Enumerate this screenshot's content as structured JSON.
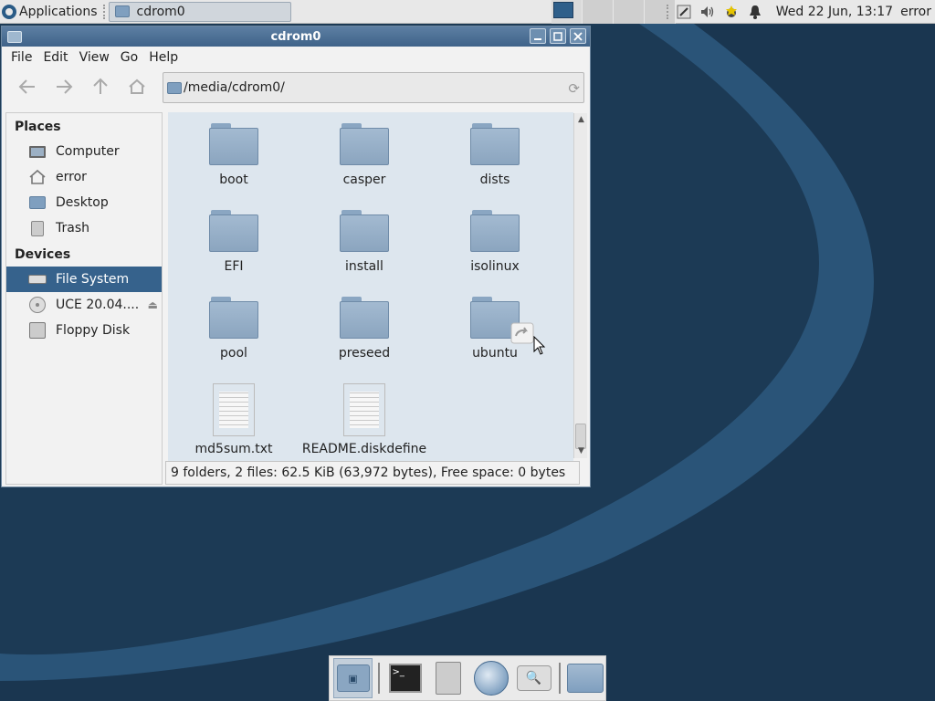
{
  "top_panel": {
    "applications_label": "Applications",
    "task_label": "cdrom0",
    "clock": "Wed 22 Jun, 13:17",
    "user": "error"
  },
  "window": {
    "title": "cdrom0",
    "menu": [
      "File",
      "Edit",
      "View",
      "Go",
      "Help"
    ],
    "path": "/media/cdrom0/",
    "sidebar": {
      "places_heading": "Places",
      "places": [
        {
          "label": "Computer",
          "icon": "computer-icon"
        },
        {
          "label": "error",
          "icon": "home-icon"
        },
        {
          "label": "Desktop",
          "icon": "desktop-icon"
        },
        {
          "label": "Trash",
          "icon": "trash-icon"
        }
      ],
      "devices_heading": "Devices",
      "devices": [
        {
          "label": "File System",
          "icon": "drive-icon",
          "selected": true
        },
        {
          "label": "UCE 20.04....",
          "icon": "disc-icon"
        },
        {
          "label": "Floppy Disk",
          "icon": "floppy-icon"
        }
      ]
    },
    "files": [
      {
        "name": "boot",
        "type": "folder"
      },
      {
        "name": "casper",
        "type": "folder"
      },
      {
        "name": "dists",
        "type": "folder"
      },
      {
        "name": "EFI",
        "type": "folder"
      },
      {
        "name": "install",
        "type": "folder"
      },
      {
        "name": "isolinux",
        "type": "folder"
      },
      {
        "name": "pool",
        "type": "folder"
      },
      {
        "name": "preseed",
        "type": "folder"
      },
      {
        "name": "ubuntu",
        "type": "folder-link"
      },
      {
        "name": "md5sum.txt",
        "type": "file"
      },
      {
        "name": "README.diskdefine",
        "type": "file"
      }
    ],
    "status": "9 folders, 2 files: 62.5 KiB (63,972 bytes), Free space: 0 bytes"
  },
  "colors": {
    "desktop": "#1c3a55",
    "selection": "#36628c",
    "titlebar": "#4a6d93"
  }
}
